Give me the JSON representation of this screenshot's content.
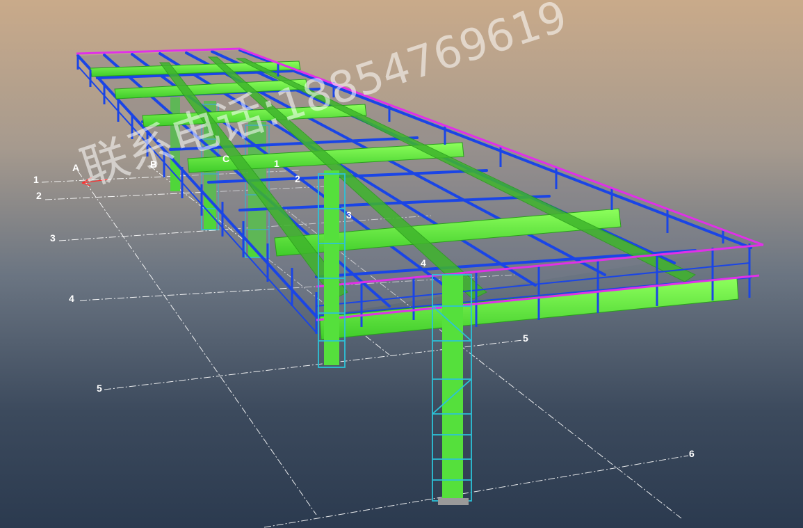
{
  "grid_labels": {
    "a": "A",
    "b": "B",
    "c": "C",
    "one": "1",
    "two": "2",
    "three": "3",
    "four": "4",
    "five": "5",
    "six": "6"
  },
  "watermark": {
    "prefix": "联系电话:",
    "phone": "18854769619"
  },
  "colors": {
    "primary_beam": "#66f23a",
    "secondary_beam": "#1a45e6",
    "handrail": "#e030e8",
    "column_cage": "#2cc2d8",
    "grid_line": "#ffffff",
    "axis_marker": "#ff3030"
  }
}
